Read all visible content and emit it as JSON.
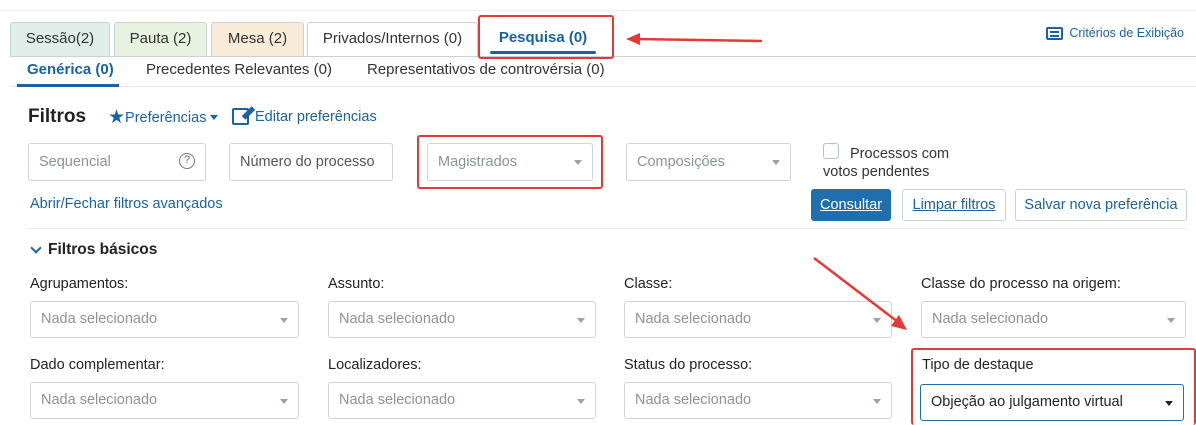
{
  "tabs": [
    {
      "label": "Sessão(2)"
    },
    {
      "label": "Pauta (2)"
    },
    {
      "label": "Mesa (2)"
    },
    {
      "label": "Privados/Internos (0)"
    },
    {
      "label": "Pesquisa (0)"
    }
  ],
  "criterios_label": "Critérios de Exibição",
  "subtabs": [
    {
      "label": "Genérica (0)"
    },
    {
      "label": "Precedentes Relevantes (0)"
    },
    {
      "label": "Representativos de controvérsia (0)"
    }
  ],
  "filtros": {
    "title": "Filtros",
    "preferencias": "Preferências",
    "editar": "Editar preferências",
    "sequencial_placeholder": "Sequencial",
    "help_glyph": "?",
    "numero_placeholder": "Número do processo",
    "magistrados": "Magistrados",
    "composicoes": "Composições",
    "checkbox_label_1": "Processos com",
    "checkbox_label_2": "votos pendentes",
    "abrir_fechar": "Abrir/Fechar filtros avançados",
    "consultar": "Consultar",
    "limpar": "Limpar filtros",
    "salvar": "Salvar nova preferência"
  },
  "basicos": {
    "title": "Filtros básicos",
    "fields": [
      {
        "label": "Agrupamentos:",
        "value": "Nada selecionado"
      },
      {
        "label": "Assunto:",
        "value": "Nada selecionado"
      },
      {
        "label": "Classe:",
        "value": "Nada selecionado"
      },
      {
        "label": "Classe do processo na origem:",
        "value": "Nada selecionado"
      },
      {
        "label": "Dado complementar:",
        "value": "Nada selecionado"
      },
      {
        "label": "Localizadores:",
        "value": "Nada selecionado"
      },
      {
        "label": "Status do processo:",
        "value": "Nada selecionado"
      },
      {
        "label": "Tipo de destaque",
        "value": "Objeção ao julgamento virtual"
      }
    ]
  },
  "colors": {
    "accent": "#1b62a3",
    "annotation": "#e53935"
  }
}
